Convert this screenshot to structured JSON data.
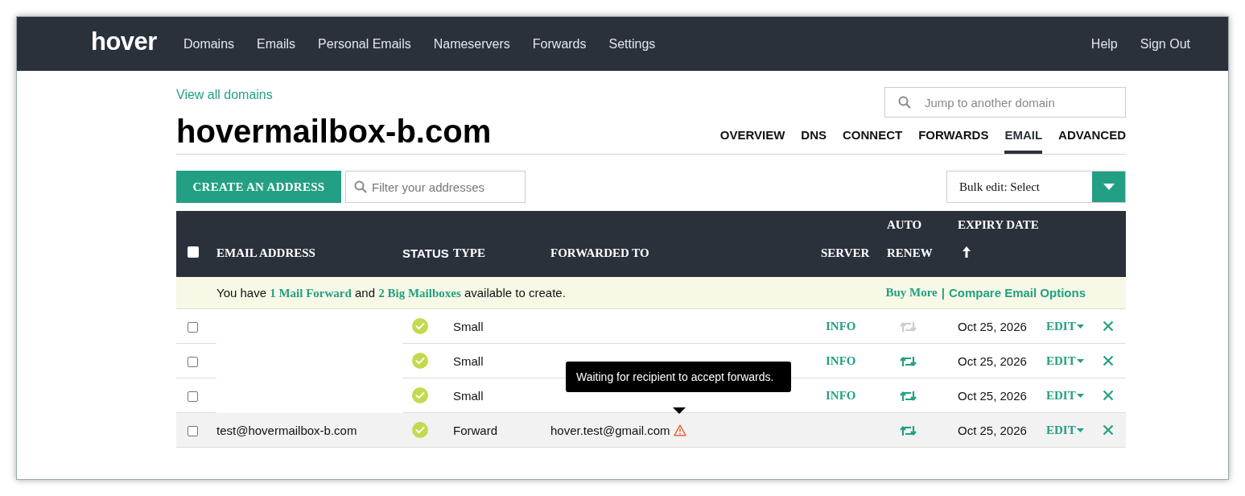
{
  "nav": {
    "logo": "hover",
    "links": [
      "Domains",
      "Emails",
      "Personal Emails",
      "Nameservers",
      "Forwards",
      "Settings"
    ],
    "right_links": [
      "Help",
      "Sign Out"
    ]
  },
  "breadcrumb": "View all domains",
  "search": {
    "placeholder": "Jump to another domain"
  },
  "domain_title": "hovermailbox-b.com",
  "tabs": [
    {
      "label": "OVERVIEW",
      "selected": false
    },
    {
      "label": "DNS",
      "selected": false
    },
    {
      "label": "CONNECT",
      "selected": false
    },
    {
      "label": "FORWARDS",
      "selected": false
    },
    {
      "label": "EMAIL",
      "selected": true
    },
    {
      "label": "ADVANCED",
      "selected": false
    }
  ],
  "create_button": "CREATE AN ADDRESS",
  "filter": {
    "placeholder": "Filter your addresses"
  },
  "bulk_edit": {
    "label": "Bulk edit: Select"
  },
  "table": {
    "select_all": {
      "checked": false
    },
    "columns": [
      {
        "label": "EMAIL ADDRESS"
      },
      {
        "label": "STATUS"
      },
      {
        "label": "TYPE"
      },
      {
        "label": "FORWARDED TO"
      },
      {
        "label": "SERVER"
      },
      {
        "label": "AUTO RENEW"
      },
      {
        "label": "EXPIRY DATE",
        "sorted": true,
        "sort_ascending": true
      }
    ],
    "notice": {
      "segments": [
        {
          "text": "You have ",
          "link": false
        },
        {
          "text": "1 Mail Forward",
          "link": true
        },
        {
          "text": " and ",
          "link": false
        },
        {
          "text": "2 Big Mailboxes",
          "link": true
        },
        {
          "text": " available to create.",
          "link": false
        }
      ],
      "actions": [
        "Buy More",
        "Compare Email Options"
      ],
      "separator": "|"
    },
    "rows": [
      {
        "checked": false,
        "hovered": false,
        "active": true,
        "type": "Small",
        "server": "INFO",
        "auto_renew": false,
        "expiry": "Oct 25, 2026",
        "edit": "EDIT"
      },
      {
        "checked": false,
        "hovered": false,
        "active": true,
        "type": "Small",
        "server": "INFO",
        "auto_renew": true,
        "expiry": "Oct 25, 2026",
        "edit": "EDIT"
      },
      {
        "checked": false,
        "hovered": false,
        "active": true,
        "type": "Small",
        "server": "INFO",
        "auto_renew": true,
        "expiry": "Oct 25, 2026",
        "edit": "EDIT"
      },
      {
        "checked": false,
        "hovered": true,
        "email": "test@hovermailbox-b.com",
        "active": true,
        "type": "Forward",
        "forwarded_to": "hover.test@gmail.com",
        "forward_warning": true,
        "auto_renew": true,
        "expiry": "Oct 25, 2026",
        "edit": "EDIT"
      }
    ]
  },
  "tooltip": {
    "text": "Waiting for recipient to accept forwards."
  }
}
